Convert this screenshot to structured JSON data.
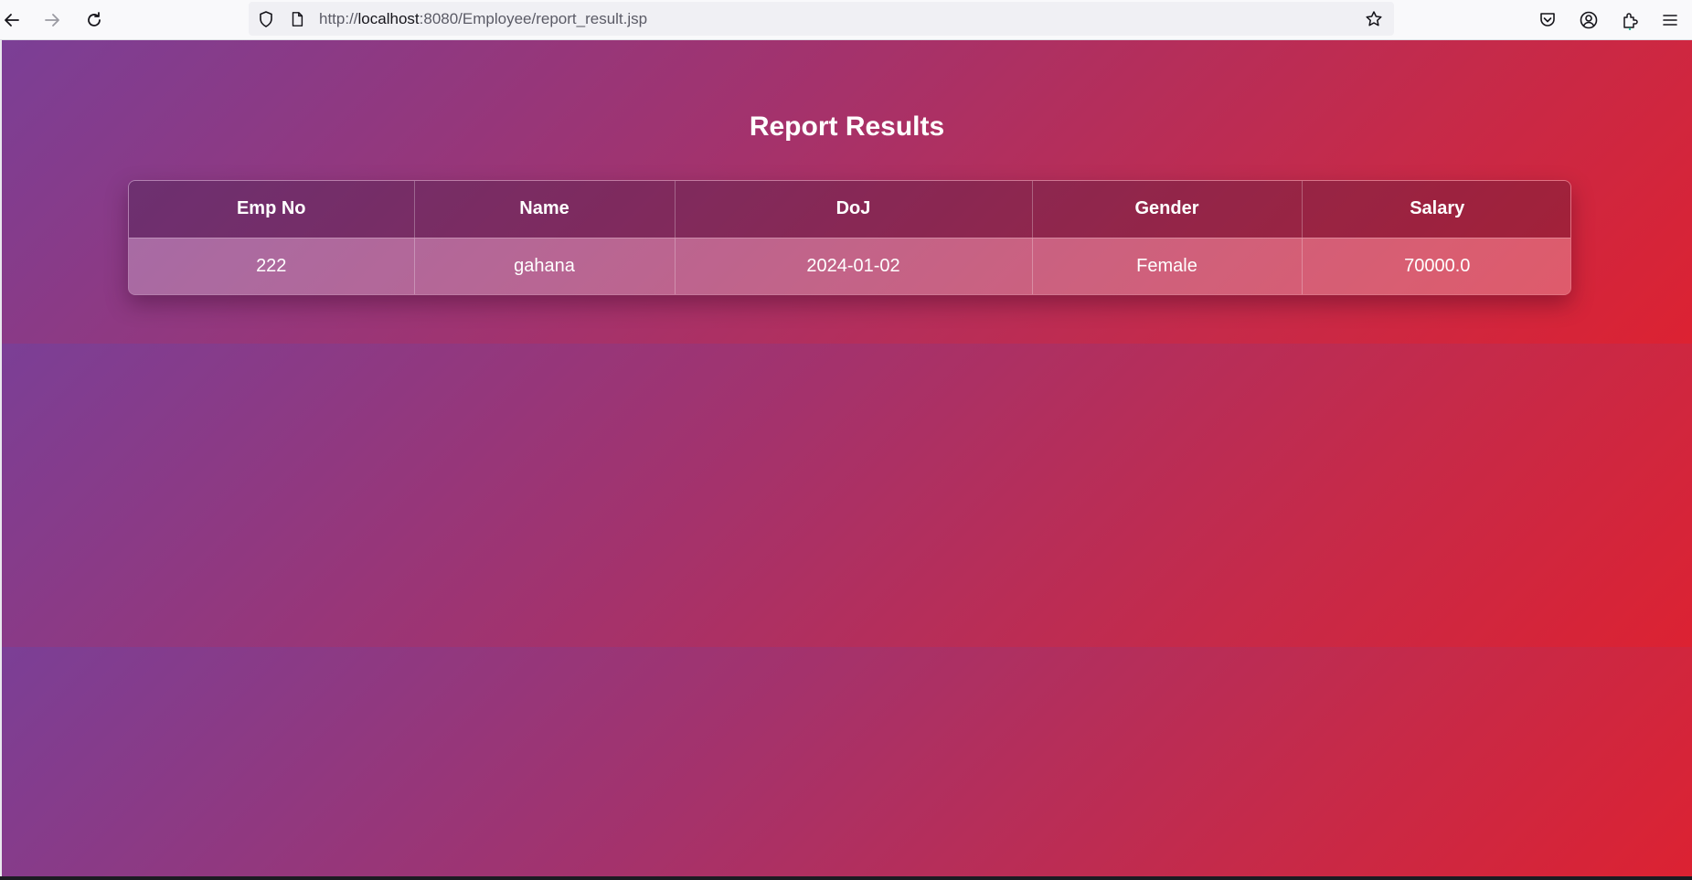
{
  "browser": {
    "url_prefix": "http://",
    "url_host": "localhost",
    "url_rest": ":8080/Employee/report_result.jsp"
  },
  "page": {
    "title": "Report Results"
  },
  "table": {
    "headers": [
      "Emp No",
      "Name",
      "DoJ",
      "Gender",
      "Salary"
    ],
    "rows": [
      [
        "222",
        "gahana",
        "2024-01-02",
        "Female",
        "70000.0"
      ]
    ]
  },
  "colors": {
    "gradient_start": "#7b3f96",
    "gradient_end": "#dc2232"
  }
}
